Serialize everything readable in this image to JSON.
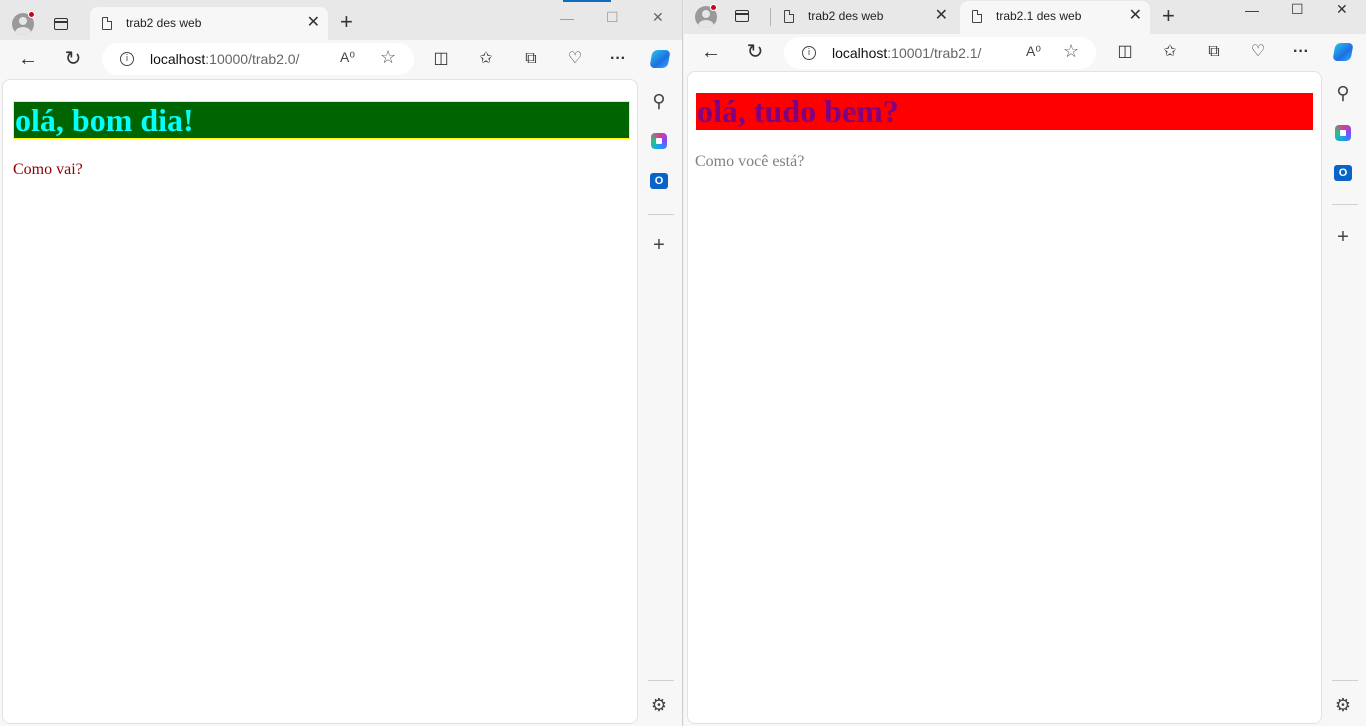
{
  "left_window": {
    "tab": {
      "title": "trab2 des web",
      "close_glyph": "✕"
    },
    "new_tab_glyph": "+",
    "window_controls": {
      "minimize": "—",
      "maximize": "☐",
      "close": "✕"
    },
    "address": {
      "host": "localhost",
      "path": ":10000/trab2.0/"
    },
    "page": {
      "heading": "olá, bom dia!",
      "paragraph": "Como vai?",
      "colors": {
        "heading_bg": "#006400",
        "heading_text": "#00ffff",
        "heading_border": "#ffff00",
        "paragraph_text": "#8b0000"
      }
    }
  },
  "right_window": {
    "tabs": [
      {
        "title": "trab2 des web",
        "close_glyph": "✕",
        "active": false
      },
      {
        "title": "trab2.1 des web",
        "close_glyph": "✕",
        "active": true
      }
    ],
    "new_tab_glyph": "+",
    "window_controls": {
      "minimize": "—",
      "maximize": "☐",
      "close": "✕"
    },
    "address": {
      "host": "localhost",
      "path": ":10001/trab2.1/"
    },
    "page": {
      "heading": "olá, tudo bem?",
      "paragraph": "Como você está?",
      "colors": {
        "heading_bg": "#ff0000",
        "heading_text": "#800080",
        "paragraph_text": "#808080"
      }
    }
  },
  "toolbar_icons": [
    "back-arrow-icon",
    "refresh-icon",
    "read-aloud-icon",
    "favorite-star-icon",
    "split-screen-icon",
    "favorites-icon",
    "collections-icon",
    "browser-essentials-icon",
    "more-options-icon",
    "copilot-icon"
  ],
  "sidebar_icons": [
    "search-icon",
    "microsoft365-icon",
    "outlook-icon",
    "add-icon",
    "settings-icon"
  ],
  "glyphs": {
    "back": "←",
    "refresh": "↻",
    "read_aloud": "A⁰",
    "star": "☆",
    "split": "◫",
    "favorites": "✩",
    "collections": "⧉",
    "essentials": "♡",
    "more": "···",
    "search": "⚲",
    "add": "+",
    "settings": "⚙",
    "info": "i",
    "outlook_letter": "O"
  }
}
